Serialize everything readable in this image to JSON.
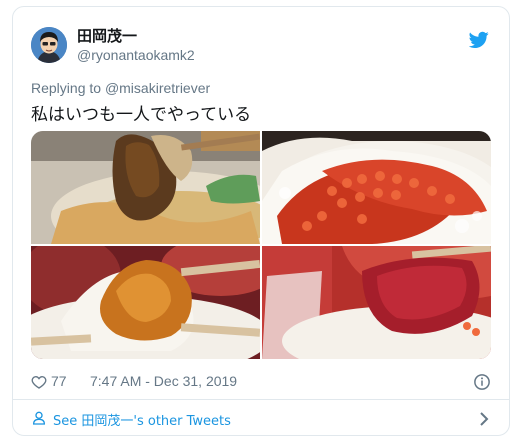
{
  "tweet": {
    "display_name": "田岡茂一",
    "handle": "@ryonantaokamk2",
    "replying_prefix": "Replying to",
    "replying_to": "@misakiretriever",
    "text": "私はいつも一人でやっている",
    "like_count": "77",
    "timestamp": "7:47 AM - Dec 31, 2019",
    "see_other": "See 田岡茂一's other Tweets"
  },
  "icons": {
    "brand": "twitter-bird-icon",
    "like": "heart-icon",
    "info": "info-icon",
    "profile": "person-icon",
    "more": "chevron-right-icon"
  },
  "colors": {
    "brand_blue": "#1da1f2",
    "link_blue": "#1b95e0",
    "secondary_text": "#657786",
    "border": "#e1e8ed"
  }
}
